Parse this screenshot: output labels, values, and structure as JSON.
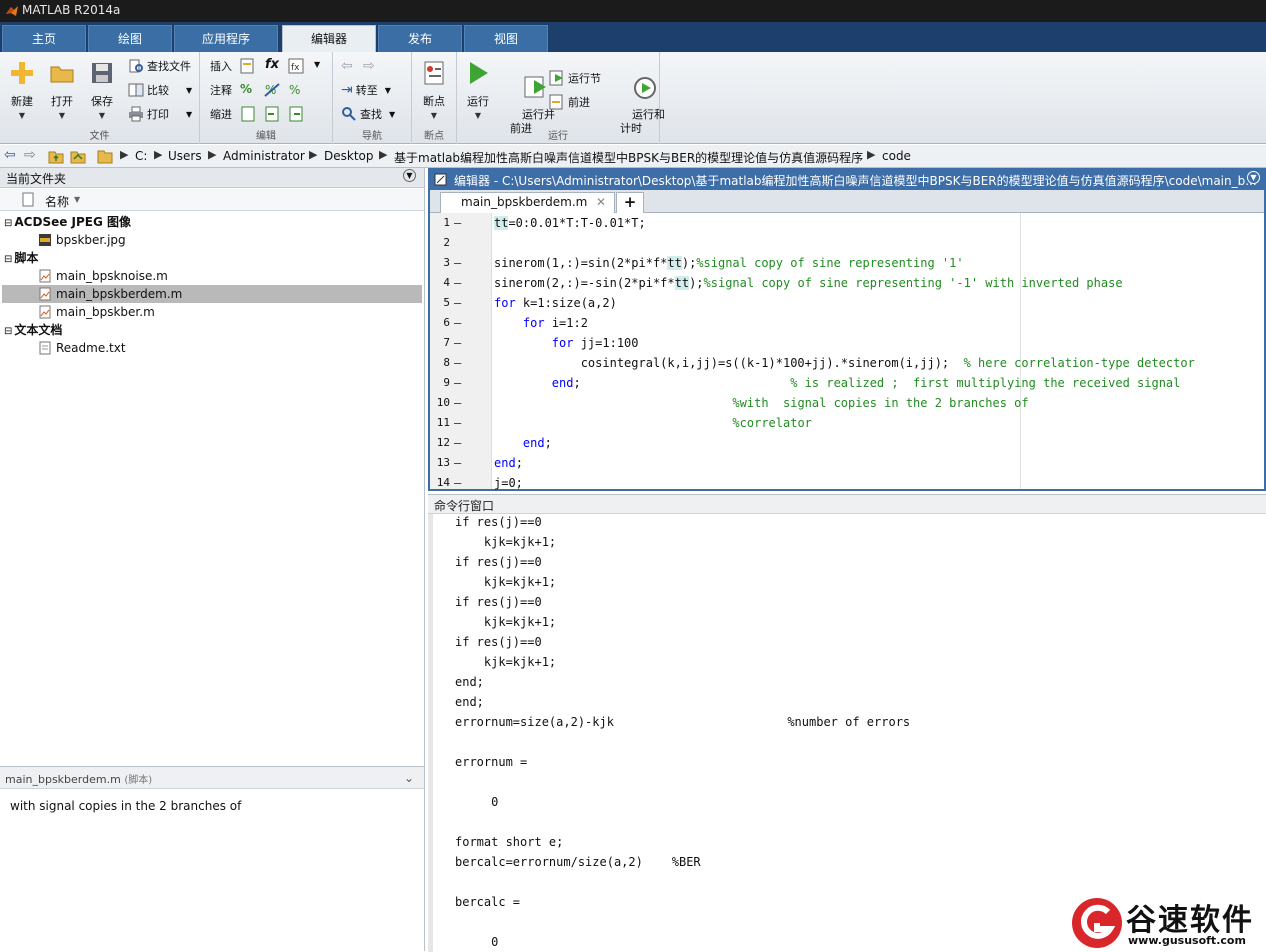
{
  "window": {
    "title": "MATLAB R2014a"
  },
  "ribbon_tabs": [
    "主页",
    "绘图",
    "应用程序",
    "编辑器",
    "发布",
    "视图"
  ],
  "ribbon": {
    "file": {
      "new": "新建",
      "open": "打开",
      "save": "保存",
      "find_files": "查找文件",
      "compare": "比较",
      "print": "打印",
      "group": "文件"
    },
    "edit": {
      "insert": "插入",
      "comment": "注释",
      "indent": "缩进",
      "fx": "fx",
      "group": "编辑"
    },
    "nav": {
      "goto": "转至",
      "find": "查找",
      "group": "导航"
    },
    "breakpoints": {
      "label": "断点",
      "group": "断点"
    },
    "run": {
      "run": "运行",
      "run_advance": "运行并\n前进",
      "run_section": "运行节",
      "advance": "前进",
      "run_time": "运行和\n计时",
      "group": "运行"
    }
  },
  "address": {
    "crumbs": [
      "C:",
      "Users",
      "Administrator",
      "Desktop",
      "基于matlab编程加性高斯白噪声信道模型中BPSK与BER的模型理论值与仿真值源码程序",
      "code"
    ]
  },
  "current_folder": {
    "title": "当前文件夹",
    "col_name": "名称",
    "groups": [
      {
        "name": "ACDSee JPEG 图像",
        "files": [
          "bpskber.jpg"
        ]
      },
      {
        "name": "脚本",
        "files": [
          "main_bpsknoise.m",
          "main_bpskberdem.m",
          "main_bpskber.m"
        ]
      },
      {
        "name": "文本文档",
        "files": [
          "Readme.txt"
        ]
      }
    ],
    "selected": "main_bpskberdem.m"
  },
  "details": {
    "header": "main_bpskberdem.m",
    "header_type": "(脚本)",
    "text": "with  signal copies in the 2 branches of"
  },
  "editor": {
    "title": "编辑器 - C:\\Users\\Administrator\\Desktop\\基于matlab编程加性高斯白噪声信道模型中BPSK与BER的模型理论值与仿真值源码程序\\code\\main_b...",
    "tab": "main_bpskberdem.m",
    "add_tab": "+",
    "lines": [
      {
        "n": "1",
        "code": "tt=0:0.01*T:T-0.01*T;"
      },
      {
        "n": "2",
        "code": ""
      },
      {
        "n": "3",
        "code": "sinerom(1,:)=sin(2*pi*f*tt);%signal copy of sine representing '1'"
      },
      {
        "n": "4",
        "code": "sinerom(2,:)=-sin(2*pi*f*tt);%signal copy of sine representing '-1' with inverted phase"
      },
      {
        "n": "5",
        "code": "for k=1:size(a,2)"
      },
      {
        "n": "6",
        "code": "    for i=1:2"
      },
      {
        "n": "7",
        "code": "        for jj=1:100"
      },
      {
        "n": "8",
        "code": "            cosintegral(k,i,jj)=s((k-1)*100+jj).*sinerom(i,jj);  % here correlation-type detector"
      },
      {
        "n": "9",
        "code": "        end;                             % is realized ;  first multiplying the received signal"
      },
      {
        "n": "10",
        "code": "                                 %with  signal copies in the 2 branches of"
      },
      {
        "n": "11",
        "code": "                                 %correlator"
      },
      {
        "n": "12",
        "code": "    end;"
      },
      {
        "n": "13",
        "code": "end;"
      },
      {
        "n": "14",
        "code": "j=0;"
      }
    ]
  },
  "command_window": {
    "title": "命令行窗口",
    "lines": [
      "if res(j)==0",
      "    kjk=kjk+1;",
      "if res(j)==0",
      "    kjk=kjk+1;",
      "if res(j)==0",
      "    kjk=kjk+1;",
      "if res(j)==0",
      "    kjk=kjk+1;",
      "end;",
      "end;",
      "errornum=size(a,2)-kjk                        %number of errors",
      "",
      "errornum =",
      "",
      "     0",
      "",
      "format short e;",
      "bercalc=errornum/size(a,2)    %BER",
      "",
      "bercalc =",
      "",
      "     0"
    ]
  },
  "watermark": {
    "brand": "谷速软件",
    "url": "www.gususoft.com"
  },
  "colors": {
    "accent": "#3d6ea7",
    "title_bg": "#1b1b1b",
    "tab_bg": "#1d3f6c",
    "selected_row": "#b9b9b9",
    "comment": "#228b22",
    "string": "#a020f0",
    "keyword": "#0000ff"
  }
}
